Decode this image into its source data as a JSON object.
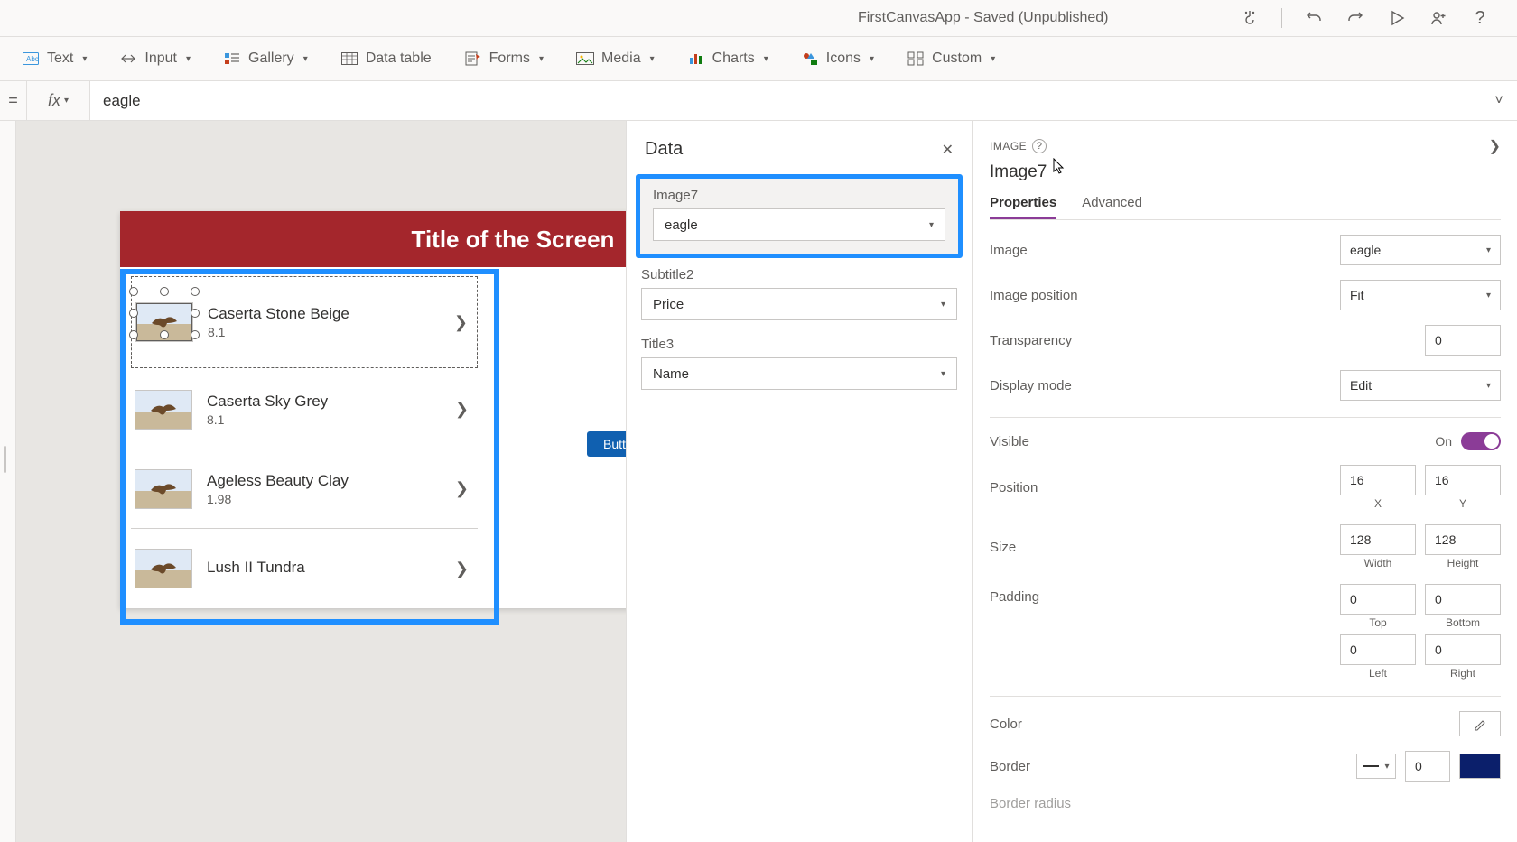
{
  "titlebar": {
    "title": "FirstCanvasApp - Saved (Unpublished)"
  },
  "ribbon": {
    "text": "Text",
    "input": "Input",
    "gallery": "Gallery",
    "datatable": "Data table",
    "forms": "Forms",
    "media": "Media",
    "charts": "Charts",
    "icons": "Icons",
    "custom": "Custom"
  },
  "formula": {
    "eq": "=",
    "fx": "fx",
    "value": "eagle"
  },
  "screen": {
    "header": "Title of the Screen",
    "button": "Butt"
  },
  "gallery_items": [
    {
      "title": "Caserta Stone Beige",
      "subtitle": "8.1"
    },
    {
      "title": "Caserta Sky Grey",
      "subtitle": "8.1"
    },
    {
      "title": "Ageless Beauty Clay",
      "subtitle": "1.98"
    },
    {
      "title": "Lush II Tundra",
      "subtitle": ""
    }
  ],
  "data_panel": {
    "title": "Data",
    "fields": [
      {
        "label": "Image7",
        "value": "eagle"
      },
      {
        "label": "Subtitle2",
        "value": "Price"
      },
      {
        "label": "Title3",
        "value": "Name"
      }
    ]
  },
  "props": {
    "type": "IMAGE",
    "name": "Image7",
    "tabs": {
      "properties": "Properties",
      "advanced": "Advanced"
    },
    "rows": {
      "image_label": "Image",
      "image_value": "eagle",
      "imgpos_label": "Image position",
      "imgpos_value": "Fit",
      "transparency_label": "Transparency",
      "transparency_value": "0",
      "display_label": "Display mode",
      "display_value": "Edit",
      "visible_label": "Visible",
      "visible_value": "On",
      "position_label": "Position",
      "x": "16",
      "y": "16",
      "x_sub": "X",
      "y_sub": "Y",
      "size_label": "Size",
      "w": "128",
      "h": "128",
      "w_sub": "Width",
      "h_sub": "Height",
      "padding_label": "Padding",
      "pt": "0",
      "pb": "0",
      "pl": "0",
      "pr": "0",
      "pt_sub": "Top",
      "pb_sub": "Bottom",
      "pl_sub": "Left",
      "pr_sub": "Right",
      "color_label": "Color",
      "border_label": "Border",
      "border_width": "0",
      "radius_label": "Border radius"
    }
  }
}
